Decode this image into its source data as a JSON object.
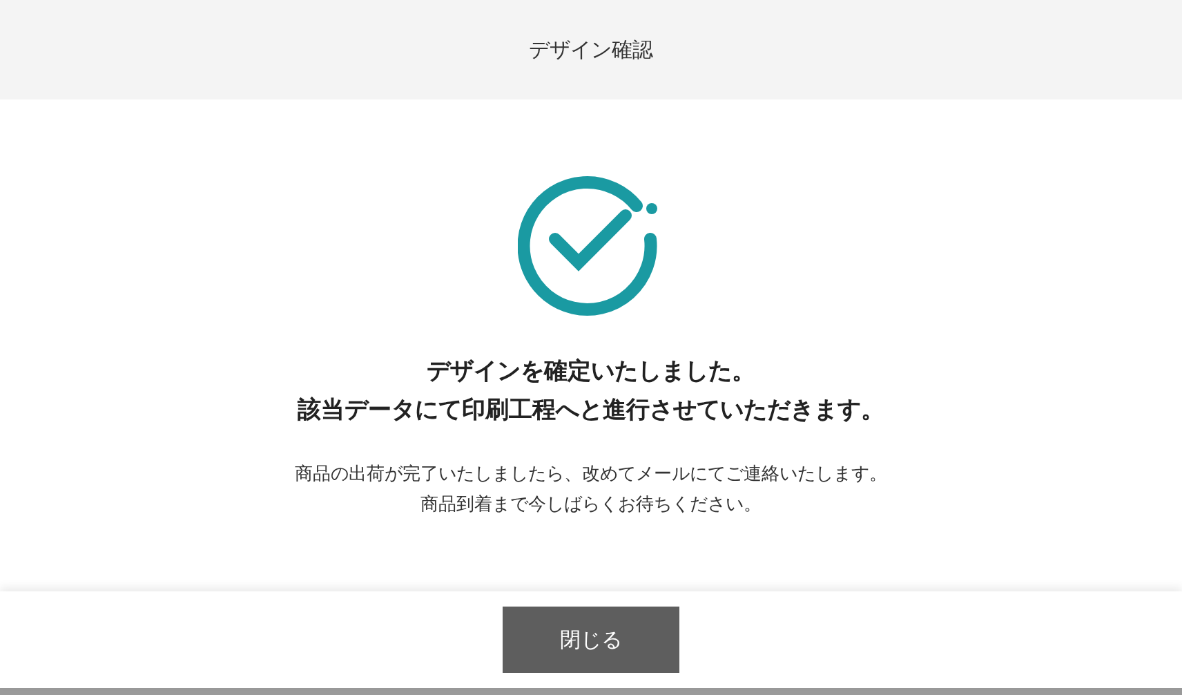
{
  "dialog": {
    "title": "デザイン確認",
    "headline": [
      "デザインを確定いたしました。",
      "該当データにて印刷工程へと進行させていただきます。"
    ],
    "message": [
      "商品の出荷が完了いたしましたら、改めてメールにてご連絡いたします。",
      "商品到着まで今しばらくお待ちください。"
    ],
    "close_button": "閉じる"
  }
}
